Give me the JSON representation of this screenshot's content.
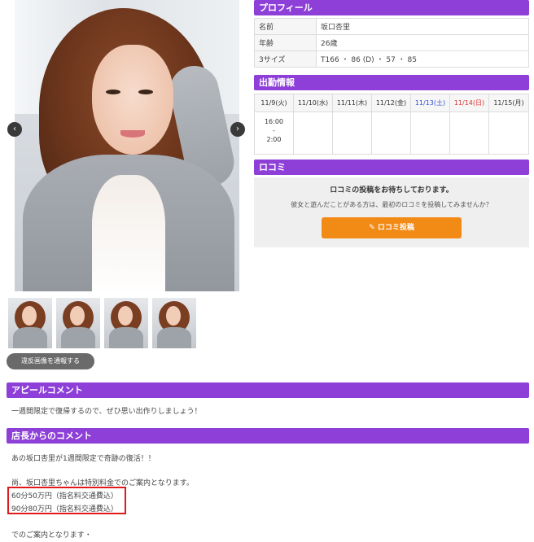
{
  "gallery": {
    "prev_icon": "‹",
    "next_icon": "›",
    "report_button": "違反画像を通報する"
  },
  "profile": {
    "title": "プロフィール",
    "rows": [
      {
        "key": "名前",
        "value": "坂口杏里"
      },
      {
        "key": "年齢",
        "value": "26歳"
      },
      {
        "key": "3サイズ",
        "value": "T166 ・ 86 (D) ・ 57 ・ 85"
      }
    ]
  },
  "schedule": {
    "title": "出勤情報",
    "days": [
      "11/9(火)",
      "11/10(水)",
      "11/11(木)",
      "11/12(金)",
      "11/13(土)",
      "11/14(日)",
      "11/15(月)"
    ],
    "shift": {
      "start": "16:00",
      "sep": "-",
      "end": "2:00"
    },
    "colors": {
      "saturday": "#3355cc",
      "sunday": "#dd3333"
    }
  },
  "kuchikomi": {
    "title": "ロコミ",
    "message": "ロコミの投稿をお待ちしております。",
    "sub_message": "彼女と遊んだことがある方は、最初のロコミを投稿してみませんか？",
    "button_label": "ロコミ投稿",
    "button_icon": "✎"
  },
  "appeal": {
    "title": "アピールコメント",
    "text": "一週間限定で復帰するので、ぜひ思い出作りしましょう！"
  },
  "shop_comment": {
    "title": "店長からのコメント",
    "lines": [
      "あの坂口杏里が1週間限定で奇跡の復活！！",
      "尚、坂口杏里ちゃんは特別料金でのご案内となります。",
      "60分50万円（指名料交通費込）",
      "90分80万円（指名料交通費込）",
      "でのご案内となります・"
    ]
  },
  "colors": {
    "accent": "#8d3fd8",
    "button_orange": "#f28a16",
    "highlight_red": "#e11919"
  }
}
